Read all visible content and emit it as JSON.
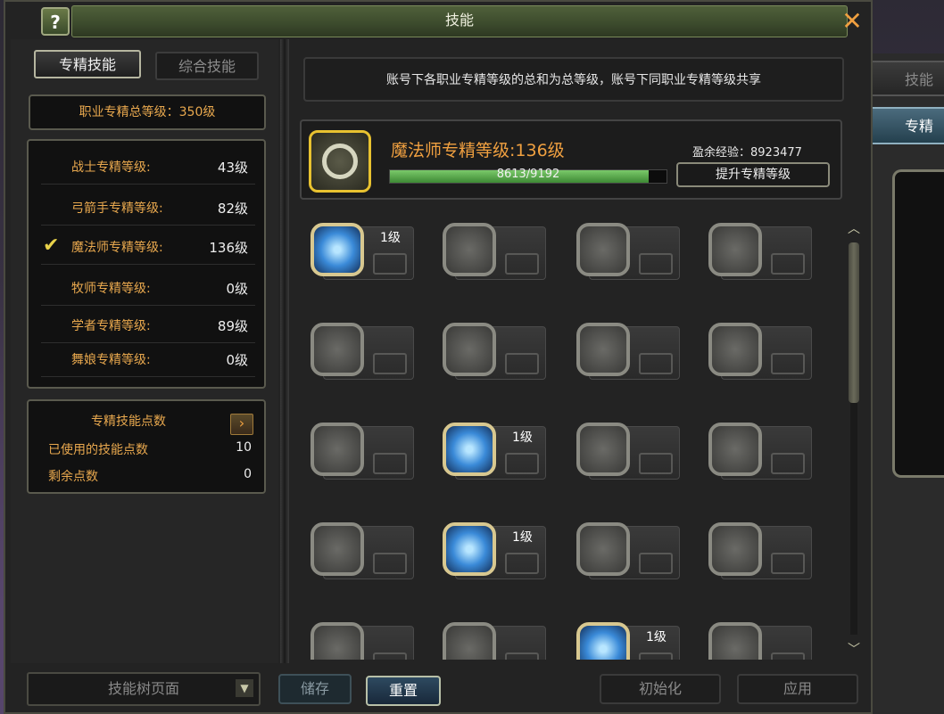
{
  "window": {
    "title": "技能",
    "help_label": "?",
    "close_label": "✕"
  },
  "tabs": {
    "active": "专精技能",
    "inactive": "综合技能"
  },
  "total_level": "职业专精总等级：350级",
  "classes": [
    {
      "name": "战士专精等级:",
      "level": "43级",
      "selected": false
    },
    {
      "name": "弓箭手专精等级:",
      "level": "82级",
      "selected": false
    },
    {
      "name": "魔法师专精等级:",
      "level": "136级",
      "selected": true
    },
    {
      "name": "牧师专精等级:",
      "level": "0级",
      "selected": false
    },
    {
      "name": "学者专精等级:",
      "level": "89级",
      "selected": false
    },
    {
      "name": "舞娘专精等级:",
      "level": "0级",
      "selected": false
    }
  ],
  "points": {
    "title": "专精技能点数",
    "used_label": "已使用的技能点数",
    "used_value": "10",
    "remaining_label": "剩余点数",
    "remaining_value": "0"
  },
  "info_text": "账号下各职业专精等级的总和为总等级，账号下同职业专精等级共享",
  "class_header": {
    "title": "魔法师专精等级:136级",
    "exp_label": "盈余经验：8923477",
    "progress_text": "8613/9192",
    "progress_fraction": 0.937,
    "levelup_label": "提升专精等级"
  },
  "skills": [
    {
      "icon": "star-icon",
      "active": true,
      "level": "1级"
    },
    {
      "icon": "fist-icon",
      "active": false,
      "level": ""
    },
    {
      "icon": "hand-icon",
      "active": false,
      "level": ""
    },
    {
      "icon": "skull-icon",
      "active": false,
      "level": ""
    },
    {
      "icon": "burst-icon",
      "active": false,
      "level": ""
    },
    {
      "icon": "flower-icon",
      "active": false,
      "level": ""
    },
    {
      "icon": "swirl-icon",
      "active": false,
      "level": ""
    },
    {
      "icon": "mp-icon",
      "active": false,
      "level": ""
    },
    {
      "icon": "wind-icon",
      "active": false,
      "level": ""
    },
    {
      "icon": "runner-icon",
      "active": true,
      "level": "1级"
    },
    {
      "icon": "creature-icon",
      "active": false,
      "level": ""
    },
    {
      "icon": "sparkle-icon",
      "active": false,
      "level": ""
    },
    {
      "icon": "orb-icon",
      "active": false,
      "level": ""
    },
    {
      "icon": "flame-icon",
      "active": true,
      "level": "1级"
    },
    {
      "icon": "claw-icon",
      "active": false,
      "level": ""
    },
    {
      "icon": "mask-icon",
      "active": false,
      "level": ""
    },
    {
      "icon": "cloud-icon",
      "active": false,
      "level": ""
    },
    {
      "icon": "palm-icon",
      "active": false,
      "level": ""
    },
    {
      "icon": "blue-fire-icon",
      "active": true,
      "level": "1级"
    },
    {
      "icon": "paw-icon",
      "active": false,
      "level": ""
    }
  ],
  "bottom": {
    "dropdown_label": "技能树页面",
    "save_label": "储存",
    "reset_label": "重置",
    "init_label": "初始化",
    "apply_label": "应用"
  },
  "side_tabs": {
    "tab1": "技能",
    "tab2": "专精"
  },
  "colors": {
    "accent_orange": "#e8a84e",
    "emblem_gold": "#e8c230",
    "progress_green": "#5aa84a"
  }
}
